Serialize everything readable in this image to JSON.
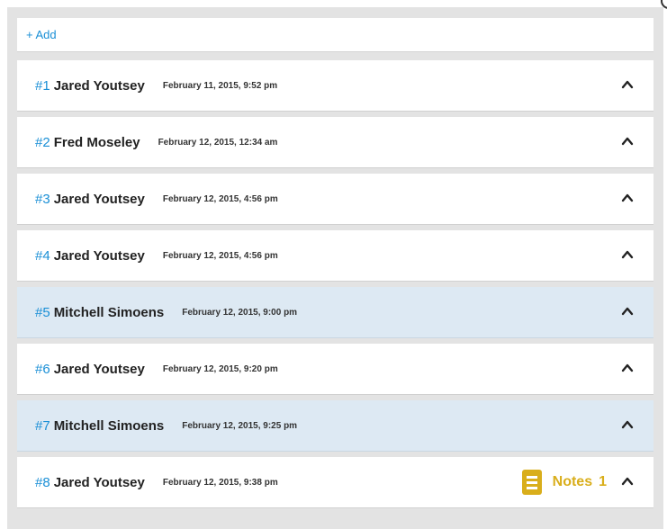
{
  "add_label": "+ Add",
  "entries": [
    {
      "num": "#1",
      "name": "Jared Youtsey",
      "date": "February 11, 2015, 9:52 pm",
      "highlighted": false
    },
    {
      "num": "#2",
      "name": "Fred Moseley",
      "date": "February 12, 2015, 12:34 am",
      "highlighted": false
    },
    {
      "num": "#3",
      "name": "Jared Youtsey",
      "date": "February 12, 2015, 4:56 pm",
      "highlighted": false
    },
    {
      "num": "#4",
      "name": "Jared Youtsey",
      "date": "February 12, 2015, 4:56 pm",
      "highlighted": false
    },
    {
      "num": "#5",
      "name": "Mitchell Simoens",
      "date": "February 12, 2015, 9:00 pm",
      "highlighted": true
    },
    {
      "num": "#6",
      "name": "Jared Youtsey",
      "date": "February 12, 2015, 9:20 pm",
      "highlighted": false
    },
    {
      "num": "#7",
      "name": "Mitchell Simoens",
      "date": "February 12, 2015, 9:25 pm",
      "highlighted": true
    },
    {
      "num": "#8",
      "name": "Jared Youtsey",
      "date": "February 12, 2015, 9:38 pm",
      "highlighted": false,
      "notes": {
        "label": "Notes",
        "count": "1"
      }
    }
  ],
  "colors": {
    "link": "#1a8fd6",
    "highlight_row": "#dde9f3",
    "notes_accent": "#d9ae1b"
  },
  "icons": {
    "expand": "chevron-up-icon",
    "notes": "notes-icon"
  }
}
